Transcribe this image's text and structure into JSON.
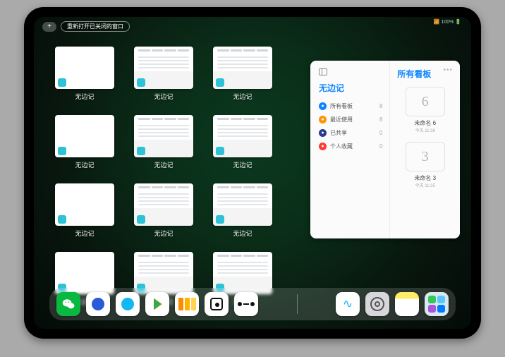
{
  "status_text": "📶 100% 🔋",
  "topbar": {
    "reopen_label": "重新打开已关闭的窗口"
  },
  "app_window_label": "无边记",
  "sidebar": {
    "title": "无边记",
    "items": [
      {
        "icon": "blue",
        "label": "所有看板",
        "count": "8"
      },
      {
        "icon": "orange",
        "label": "最近使用",
        "count": "8"
      },
      {
        "icon": "navy",
        "label": "已共享",
        "count": "0"
      },
      {
        "icon": "red",
        "label": "个人收藏",
        "count": "0"
      }
    ]
  },
  "rightpane": {
    "title": "所有看板",
    "boards": [
      {
        "glyph": "6",
        "name": "未命名 6",
        "date": "今天 11:28"
      },
      {
        "glyph": "3",
        "name": "未命名 3",
        "date": "今天 11:25"
      }
    ]
  },
  "windows": [
    {
      "style": "blank"
    },
    {
      "style": "cal"
    },
    {
      "style": "cal"
    },
    {
      "style": "blank"
    },
    {
      "style": "cal"
    },
    {
      "style": "cal"
    },
    {
      "style": "blank"
    },
    {
      "style": "cal"
    },
    {
      "style": "cal"
    },
    {
      "style": "blank"
    },
    {
      "style": "cal"
    },
    {
      "style": "cal"
    }
  ],
  "dock": {
    "left": [
      {
        "name": "wechat-icon"
      },
      {
        "name": "tencent-hd-icon"
      },
      {
        "name": "qq-icon"
      },
      {
        "name": "play-icon"
      },
      {
        "name": "books-icon"
      },
      {
        "name": "dice-icon"
      },
      {
        "name": "dumbbell-icon"
      }
    ],
    "right": [
      {
        "name": "freeform-icon"
      },
      {
        "name": "settings-icon"
      },
      {
        "name": "notes-icon"
      },
      {
        "name": "app-library-icon"
      }
    ]
  }
}
